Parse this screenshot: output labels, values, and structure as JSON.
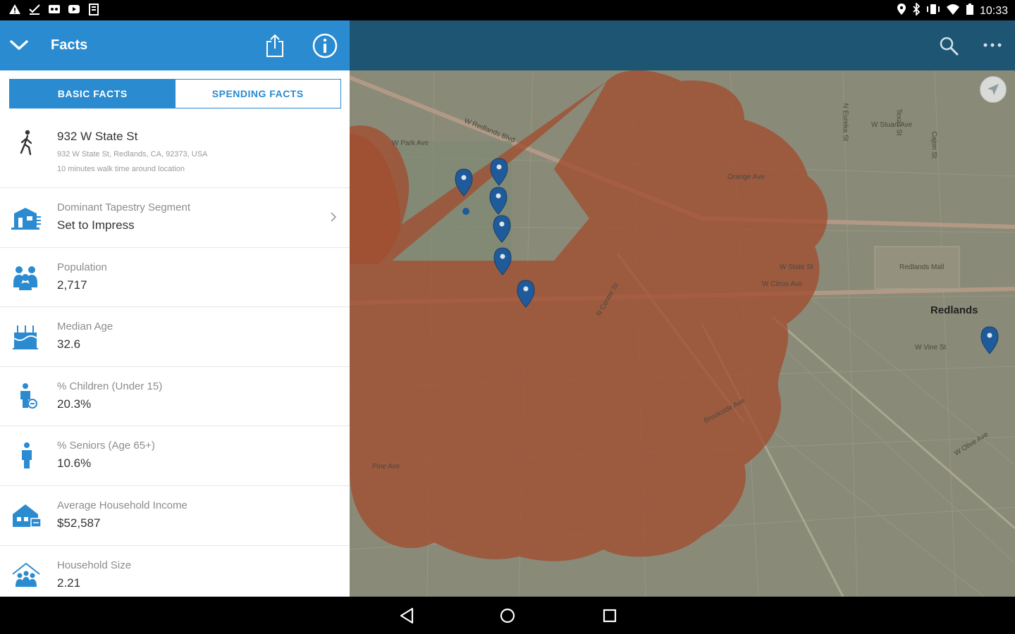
{
  "status_bar": {
    "time": "10:33",
    "left_icons": [
      "warning-icon",
      "download-done-icon",
      "voicemail-icon",
      "youtube-icon",
      "clipboard-icon"
    ],
    "right_icons": [
      "location-icon",
      "bluetooth-icon",
      "vibrate-icon",
      "wifi-icon",
      "battery-icon"
    ]
  },
  "panel": {
    "title": "Facts",
    "tabs": [
      {
        "label": "BASIC FACTS",
        "active": true
      },
      {
        "label": "SPENDING FACTS",
        "active": false
      }
    ],
    "location": {
      "name": "932 W State St",
      "address": "932 W State St, Redlands, CA, 92373, USA",
      "description": "10 minutes walk time around location"
    },
    "facts": [
      {
        "label": "Dominant Tapestry Segment",
        "value": "Set to Impress",
        "icon": "building-icon",
        "has_chevron": true
      },
      {
        "label": "Population",
        "value": "2,717",
        "icon": "people-icon"
      },
      {
        "label": "Median Age",
        "value": "32.6",
        "icon": "birthday-cake-icon"
      },
      {
        "label": "% Children (Under 15)",
        "value": "20.3%",
        "icon": "child-icon"
      },
      {
        "label": "% Seniors (Age 65+)",
        "value": "10.6%",
        "icon": "senior-icon"
      },
      {
        "label": "Average Household Income",
        "value": "$52,587",
        "icon": "house-income-icon"
      },
      {
        "label": "Household Size",
        "value": "2.21",
        "icon": "household-icon"
      }
    ]
  },
  "map": {
    "accent_color": "#1d5573",
    "area_color": "#a14d30",
    "city_label": "Redlands",
    "street_labels": [
      "W Park Ave",
      "W Redlands Blvd",
      "W Stuart Ave",
      "Orange Ave",
      "W State St",
      "W Citrus Ave",
      "W Vine St",
      "Pine Ave",
      "Brookside Ave",
      "W Olive Ave",
      "N Eureka St",
      "N Center St",
      "Texas St",
      "Cajon St",
      "Redlands Mall"
    ]
  },
  "nav_bar": {
    "buttons": [
      "back-icon",
      "home-icon",
      "recents-icon"
    ]
  }
}
